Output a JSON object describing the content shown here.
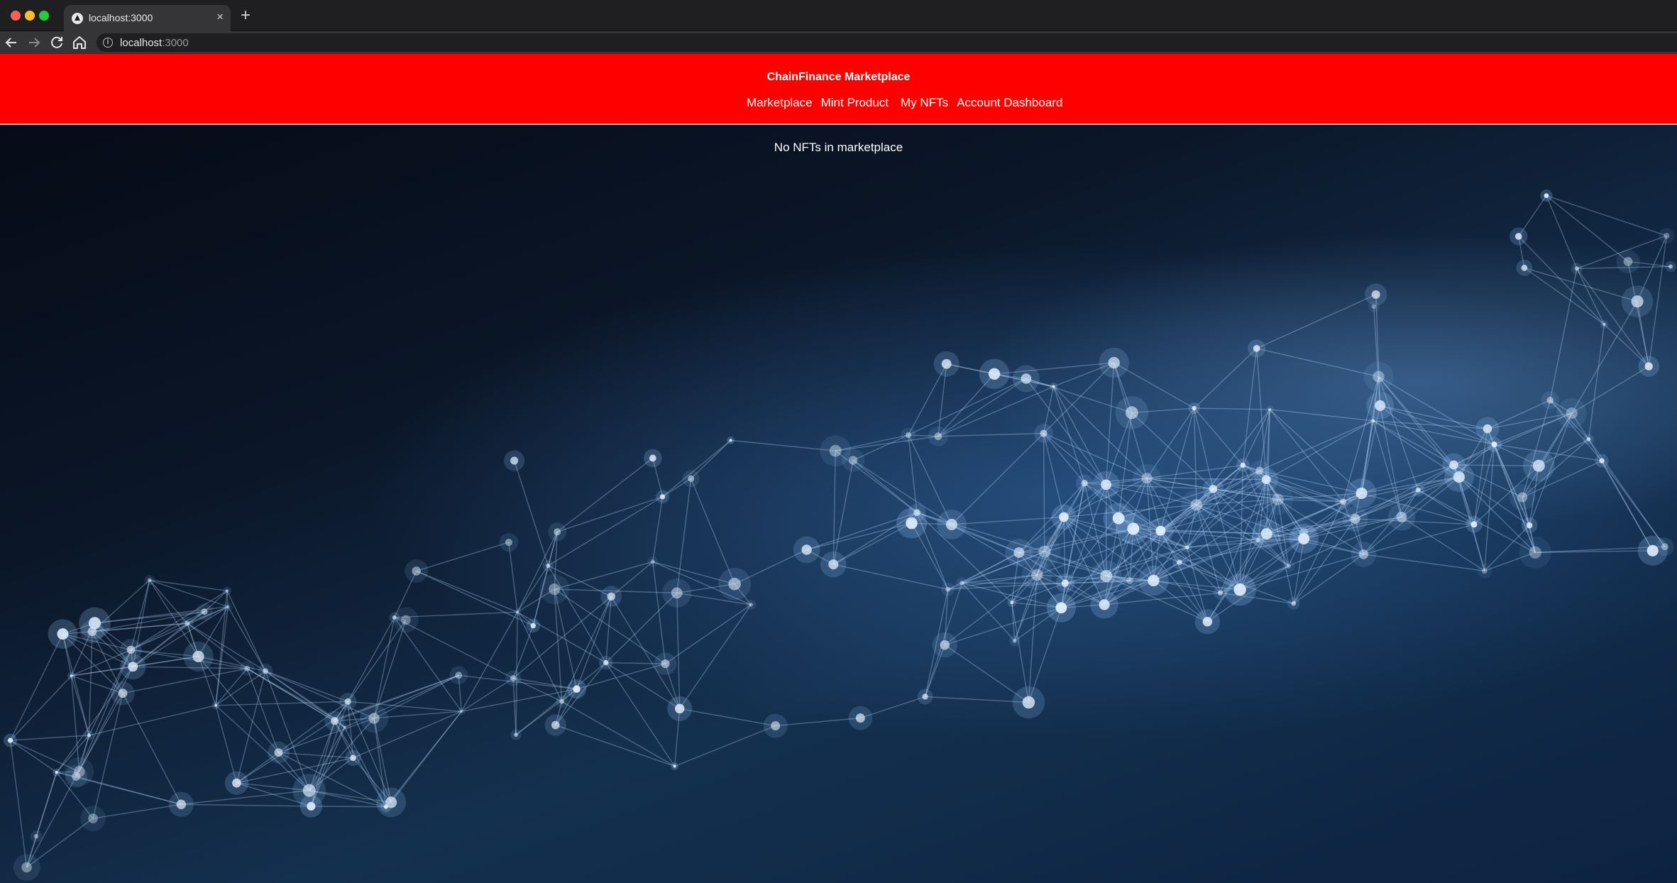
{
  "browser": {
    "tab_title": "localhost:3000",
    "tab_close": "×",
    "new_tab": "+",
    "url_host": "localhost",
    "url_rest": ":3000",
    "icons": {
      "back": "arrow-left-icon",
      "forward": "arrow-right-icon",
      "reload": "reload-icon",
      "home": "home-icon",
      "info": "info-icon"
    }
  },
  "header": {
    "brand": "ChainFinance Marketplace",
    "background_color": "#ff0000",
    "nav": {
      "marketplace": "Marketplace",
      "mint_product": "Mint Product",
      "my_nfts": "My NFTs",
      "account_dashboard": "Account Dashboard"
    }
  },
  "main": {
    "empty_message": "No NFTs in marketplace"
  },
  "background": {
    "image": "blockchain-network-mesh"
  }
}
